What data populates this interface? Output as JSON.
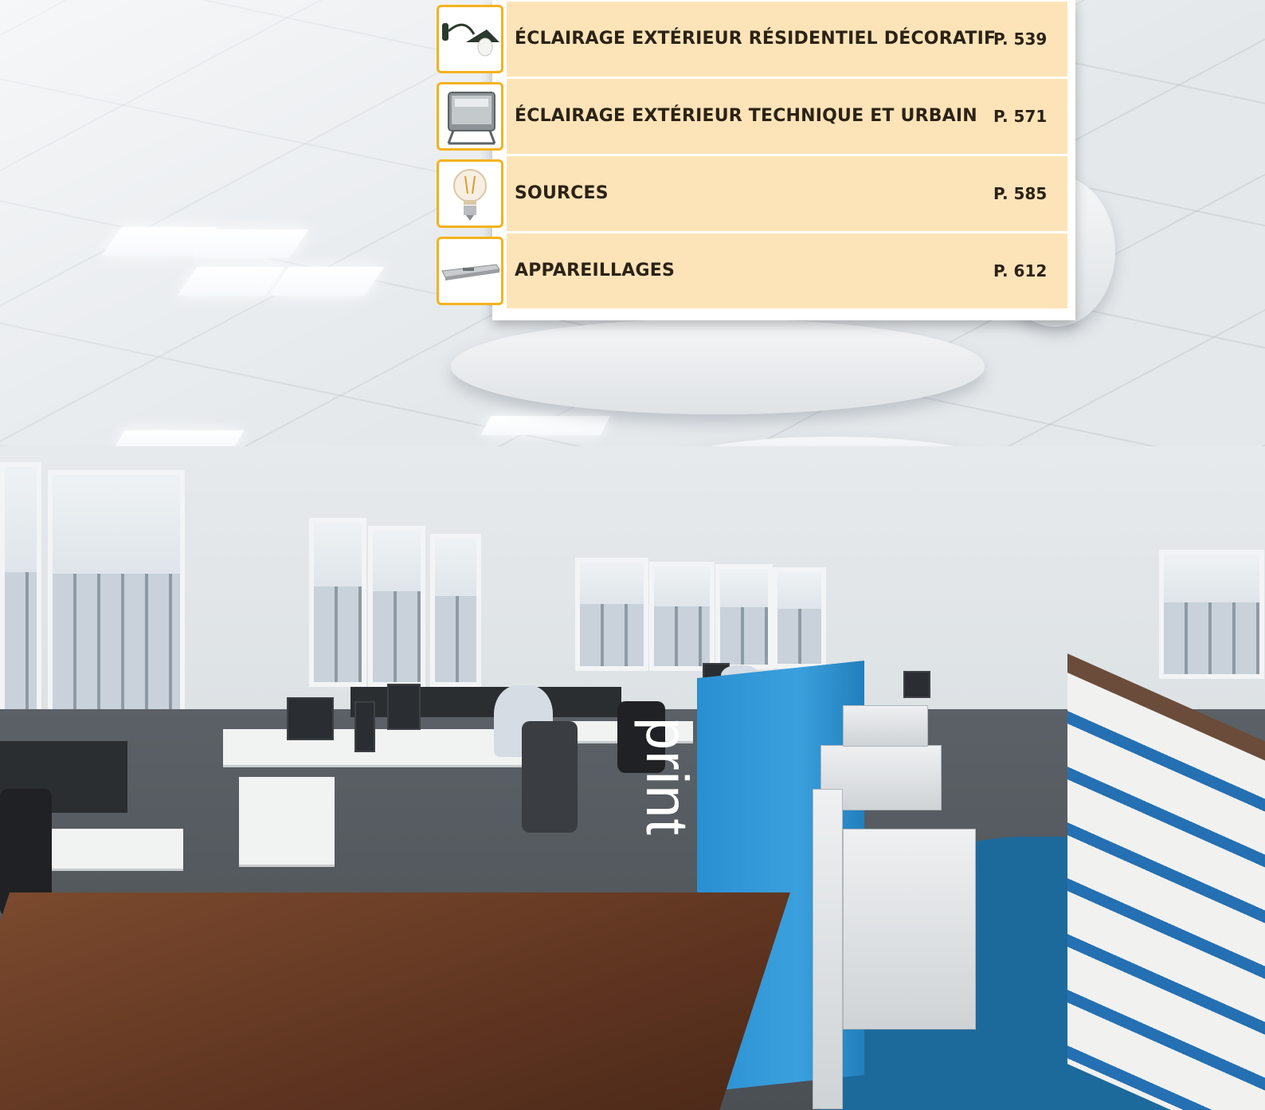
{
  "menu": {
    "items": [
      {
        "label": "ÉCLAIRAGE EXTÉRIEUR RÉSIDENTIEL DÉCORATIF",
        "page": "P. 539",
        "icon": "wall-lamp-icon"
      },
      {
        "label": "ÉCLAIRAGE EXTÉRIEUR TECHNIQUE ET URBAIN",
        "page": "P. 571",
        "icon": "floodlight-icon"
      },
      {
        "label": "SOURCES",
        "page": "P. 585",
        "icon": "light-bulb-icon"
      },
      {
        "label": "APPAREILLAGES",
        "page": "P. 612",
        "icon": "ballast-icon"
      }
    ],
    "row_color": "#fde4b8",
    "border_color": "#f4b21d",
    "text_color": "#2c2216"
  },
  "scene": {
    "signage_text": "print",
    "accent_blue": "#2a8fd0"
  }
}
